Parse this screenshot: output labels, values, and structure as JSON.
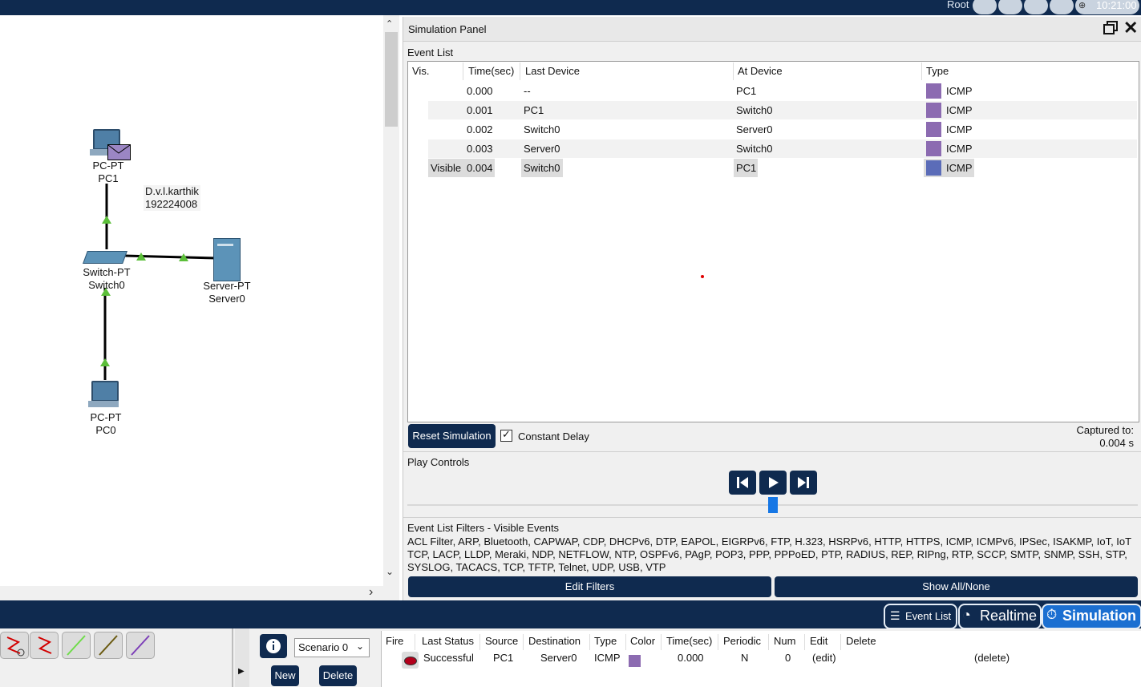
{
  "topbar": {
    "user": "Root",
    "clock": "10:21:00"
  },
  "workspace": {
    "devices": [
      {
        "type": "PC-PT",
        "name": "PC1"
      },
      {
        "type": "Switch-PT",
        "name": "Switch0"
      },
      {
        "type": "Server-PT",
        "name": "Server0"
      },
      {
        "type": "PC-PT",
        "name": "PC0"
      }
    ],
    "note": {
      "line1": "D.v.l.karthik",
      "line2": "192224008"
    }
  },
  "simulation_panel": {
    "title": "Simulation Panel",
    "event_list_label": "Event List",
    "columns": [
      "Vis.",
      "Time(sec)",
      "Last Device",
      "At Device",
      "Type"
    ],
    "events": [
      {
        "vis": "",
        "time": "0.000",
        "last": "--",
        "at": "PC1",
        "type": "ICMP",
        "color": "#8c6bb1"
      },
      {
        "vis": "",
        "time": "0.001",
        "last": "PC1",
        "at": "Switch0",
        "type": "ICMP",
        "color": "#8c6bb1"
      },
      {
        "vis": "",
        "time": "0.002",
        "last": "Switch0",
        "at": "Server0",
        "type": "ICMP",
        "color": "#8c6bb1"
      },
      {
        "vis": "",
        "time": "0.003",
        "last": "Server0",
        "at": "Switch0",
        "type": "ICMP",
        "color": "#8c6bb1"
      },
      {
        "vis": "Visible",
        "time": "0.004",
        "last": "Switch0",
        "at": "PC1",
        "type": "ICMP",
        "color": "#5b6cb8"
      }
    ],
    "reset_label": "Reset Simulation",
    "constant_delay_label": "Constant Delay",
    "captured_label": "Captured to:",
    "captured_value": "0.004 s",
    "play_controls_label": "Play Controls",
    "filters_title": "Event List Filters - Visible Events",
    "filters_text": "ACL Filter, ARP, Bluetooth, CAPWAP, CDP, DHCPv6, DTP, EAPOL, EIGRPv6, FTP, H.323, HSRPv6, HTTP, HTTPS, ICMP, ICMPv6, IPSec, ISAKMP, IoT, IoT TCP, LACP, LLDP, Meraki, NDP, NETFLOW, NTP, OSPFv6, PAgP, POP3, PPP, PPPoED, PTP, RADIUS, REP, RIPng, RTP, SCCP, SMTP, SNMP, SSH, STP, SYSLOG, TACACS, TCP, TFTP, Telnet, UDP, USB, VTP",
    "edit_filters_label": "Edit Filters",
    "show_all_label": "Show All/None"
  },
  "modes": {
    "event_list": "Event List",
    "realtime": "Realtime",
    "simulation": "Simulation"
  },
  "scenario": {
    "selected": "Scenario 0",
    "new_label": "New",
    "delete_label": "Delete"
  },
  "pdu_table": {
    "columns": [
      "Fire",
      "Last Status",
      "Source",
      "Destination",
      "Type",
      "Color",
      "Time(sec)",
      "Periodic",
      "Num",
      "Edit",
      "Delete"
    ],
    "row": {
      "status": "Successful",
      "source": "PC1",
      "destination": "Server0",
      "type": "ICMP",
      "color": "#8c6bb1",
      "time": "0.000",
      "periodic": "N",
      "num": "0",
      "edit": "(edit)",
      "delete": "(delete)"
    }
  }
}
